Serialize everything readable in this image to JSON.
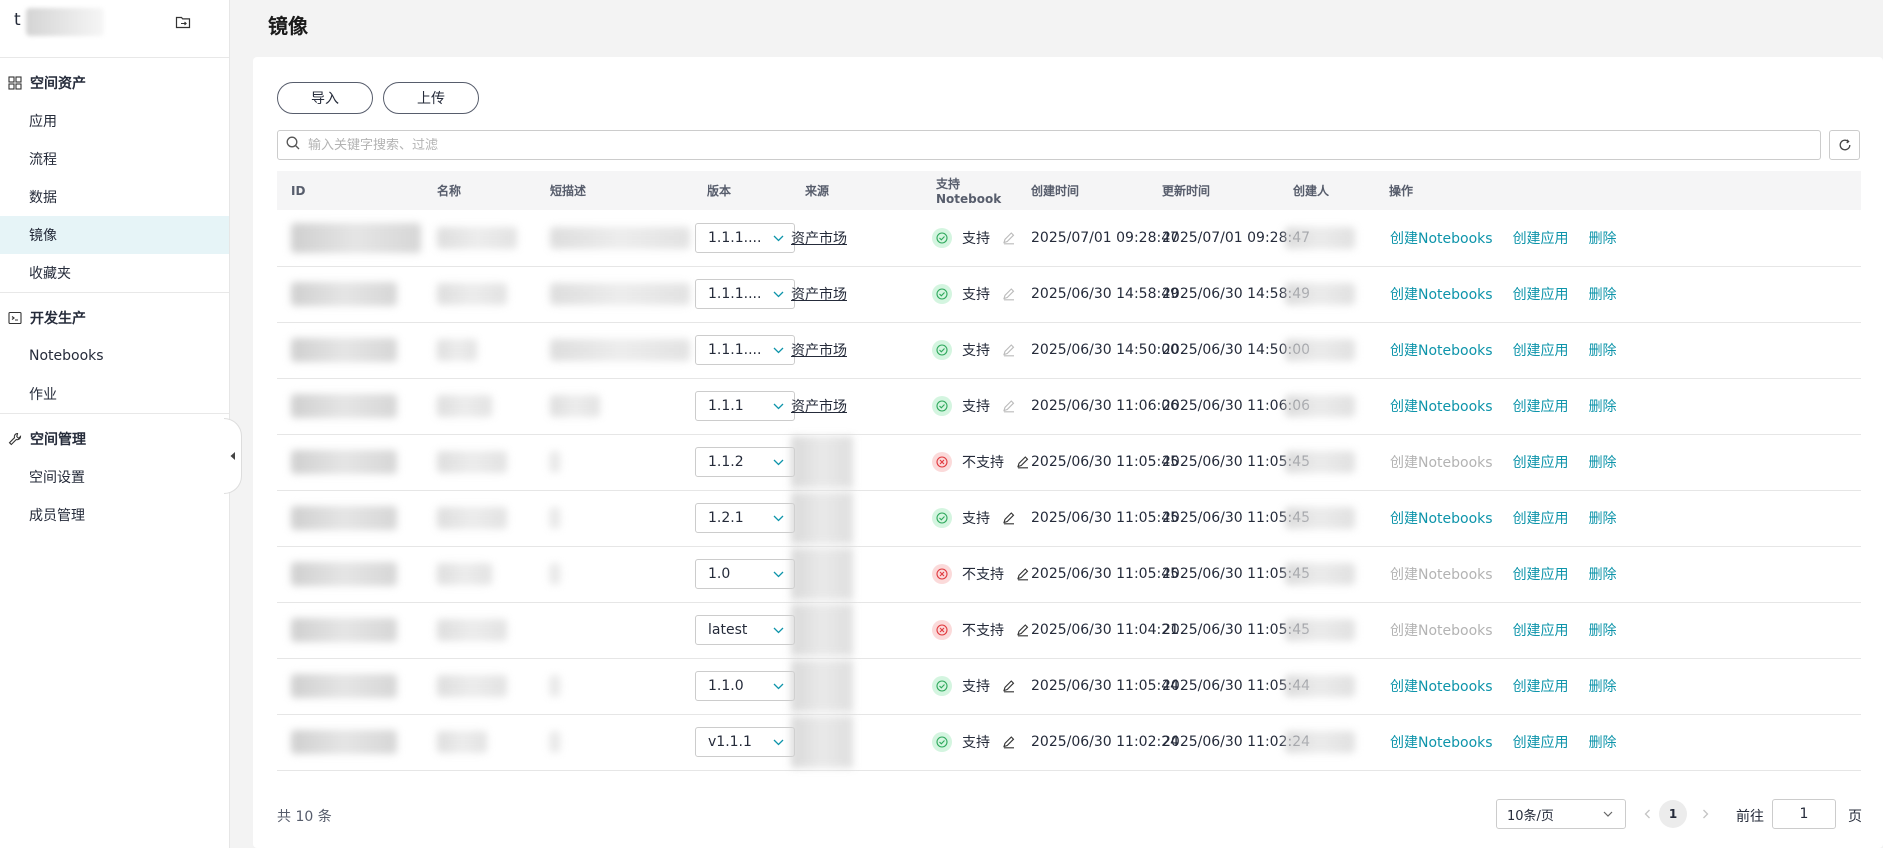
{
  "sidebar": {
    "workspace_initial": "t",
    "groups": [
      {
        "title": "空间资产",
        "icon": "grid-icon",
        "items": [
          "应用",
          "流程",
          "数据",
          "镜像",
          "收藏夹"
        ]
      },
      {
        "title": "开发生产",
        "icon": "code-box-icon",
        "items": [
          "Notebooks",
          "作业"
        ]
      },
      {
        "title": "空间管理",
        "icon": "wrench-icon",
        "items": [
          "空间设置",
          "成员管理"
        ]
      }
    ],
    "active_item": "镜像"
  },
  "page": {
    "title": "镜像"
  },
  "toolbar": {
    "import_label": "导入",
    "upload_label": "上传"
  },
  "search": {
    "placeholder": "输入关键字搜索、过滤"
  },
  "table": {
    "headers": [
      "ID",
      "名称",
      "短描述",
      "版本",
      "来源",
      "支持Notebook",
      "创建时间",
      "更新时间",
      "创建人",
      "操作"
    ],
    "rows": [
      {
        "version": "1.1.1....",
        "source": "资产市场",
        "supported": true,
        "status": "支持",
        "created": "2025/07/01 09:28:47",
        "updated": "2025/07/01 09:28:47",
        "ops": [
          "创建Notebooks",
          "创建应用",
          "删除"
        ]
      },
      {
        "version": "1.1.1....",
        "source": "资产市场",
        "supported": true,
        "status": "支持",
        "created": "2025/06/30 14:58:49",
        "updated": "2025/06/30 14:58:49",
        "ops": [
          "创建Notebooks",
          "创建应用",
          "删除"
        ]
      },
      {
        "version": "1.1.1....",
        "source": "资产市场",
        "supported": true,
        "status": "支持",
        "created": "2025/06/30 14:50:00",
        "updated": "2025/06/30 14:50:00",
        "ops": [
          "创建Notebooks",
          "创建应用",
          "删除"
        ]
      },
      {
        "version": "1.1.1",
        "source": "资产市场",
        "supported": true,
        "status": "支持",
        "created": "2025/06/30 11:06:06",
        "updated": "2025/06/30 11:06:06",
        "ops": [
          "创建Notebooks",
          "创建应用",
          "删除"
        ]
      },
      {
        "version": "1.1.2",
        "source": "",
        "supported": false,
        "status": "不支持",
        "created": "2025/06/30 11:05:45",
        "updated": "2025/06/30 11:05:45",
        "ops": [
          "创建Notebooks",
          "创建应用",
          "删除"
        ]
      },
      {
        "version": "1.2.1",
        "source": "",
        "supported": true,
        "status": "支持",
        "created": "2025/06/30 11:05:45",
        "updated": "2025/06/30 11:05:45",
        "ops": [
          "创建Notebooks",
          "创建应用",
          "删除"
        ]
      },
      {
        "version": "1.0",
        "source": "",
        "supported": false,
        "status": "不支持",
        "created": "2025/06/30 11:05:45",
        "updated": "2025/06/30 11:05:45",
        "ops": [
          "创建Notebooks",
          "创建应用",
          "删除"
        ]
      },
      {
        "version": "latest",
        "source": "",
        "supported": false,
        "status": "不支持",
        "created": "2025/06/30 11:04:21",
        "updated": "2025/06/30 11:05:45",
        "ops": [
          "创建Notebooks",
          "创建应用",
          "删除"
        ]
      },
      {
        "version": "1.1.0",
        "source": "",
        "supported": true,
        "status": "支持",
        "created": "2025/06/30 11:05:44",
        "updated": "2025/06/30 11:05:44",
        "ops": [
          "创建Notebooks",
          "创建应用",
          "删除"
        ]
      },
      {
        "version": "v1.1.1",
        "source": "",
        "supported": true,
        "status": "支持",
        "created": "2025/06/30 11:02:24",
        "updated": "2025/06/30 11:02:24",
        "ops": [
          "创建Notebooks",
          "创建应用",
          "删除"
        ]
      }
    ]
  },
  "pagination": {
    "total_label": "共 10 条",
    "page_size": "10条/页",
    "current_page": "1",
    "goto_label": "前往",
    "goto_value": "1",
    "page_unit": "页"
  },
  "colors": {
    "link": "#0d94aa",
    "active_nav_bg": "#e6f4f7",
    "ok": "#2ea85c",
    "error": "#e0393e",
    "disabled": "#b3b3b3"
  }
}
